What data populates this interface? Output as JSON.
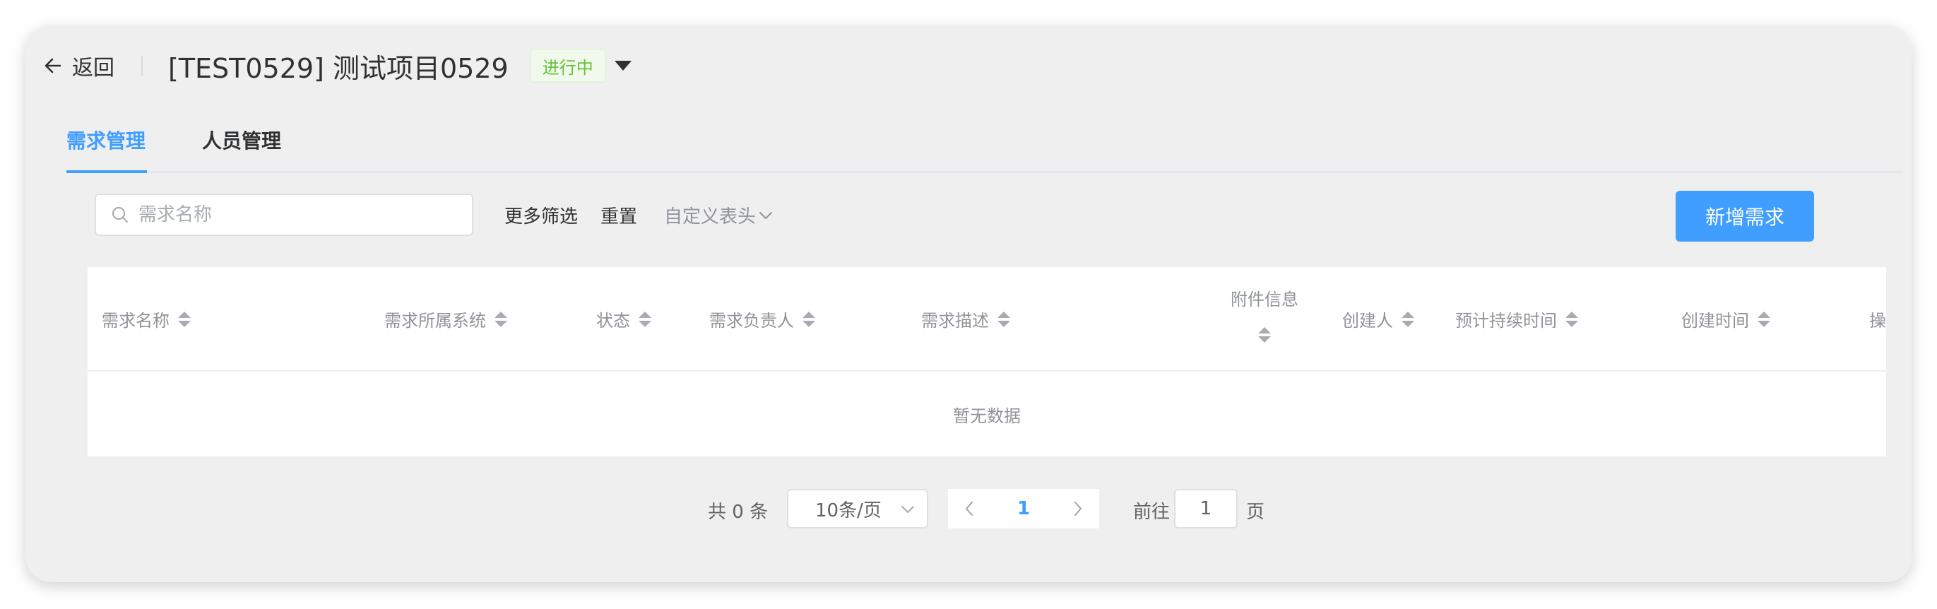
{
  "header": {
    "back_label": "返回",
    "project_title": "[TEST0529] 测试项目0529",
    "status": "进行中"
  },
  "tabs": [
    {
      "label": "需求管理",
      "active": true
    },
    {
      "label": "人员管理",
      "active": false
    }
  ],
  "toolbar": {
    "search_placeholder": "需求名称",
    "more_filters": "更多筛选",
    "reset": "重置",
    "custom_header": "自定义表头",
    "add_button": "新增需求"
  },
  "table": {
    "columns": [
      "需求名称",
      "需求所属系统",
      "状态",
      "需求负责人",
      "需求描述",
      "附件信息",
      "创建人",
      "预计持续时间",
      "创建时间",
      "操"
    ],
    "empty_text": "暂无数据"
  },
  "pagination": {
    "total_text": "共 0 条",
    "page_size": "10条/页",
    "current_page": "1",
    "goto_label": "前往",
    "goto_value": "1",
    "page_suffix": "页"
  },
  "colors": {
    "primary": "#409eff",
    "success": "#67c23a",
    "text": "#303133",
    "muted": "#909399"
  },
  "icons": {
    "back": "arrow-left-icon",
    "status_dropdown": "caret-down-icon",
    "search": "search-icon",
    "custom_header_dropdown": "chevron-down-icon",
    "sort": "sort-icon",
    "prev": "chevron-left-icon",
    "next": "chevron-right-icon"
  }
}
